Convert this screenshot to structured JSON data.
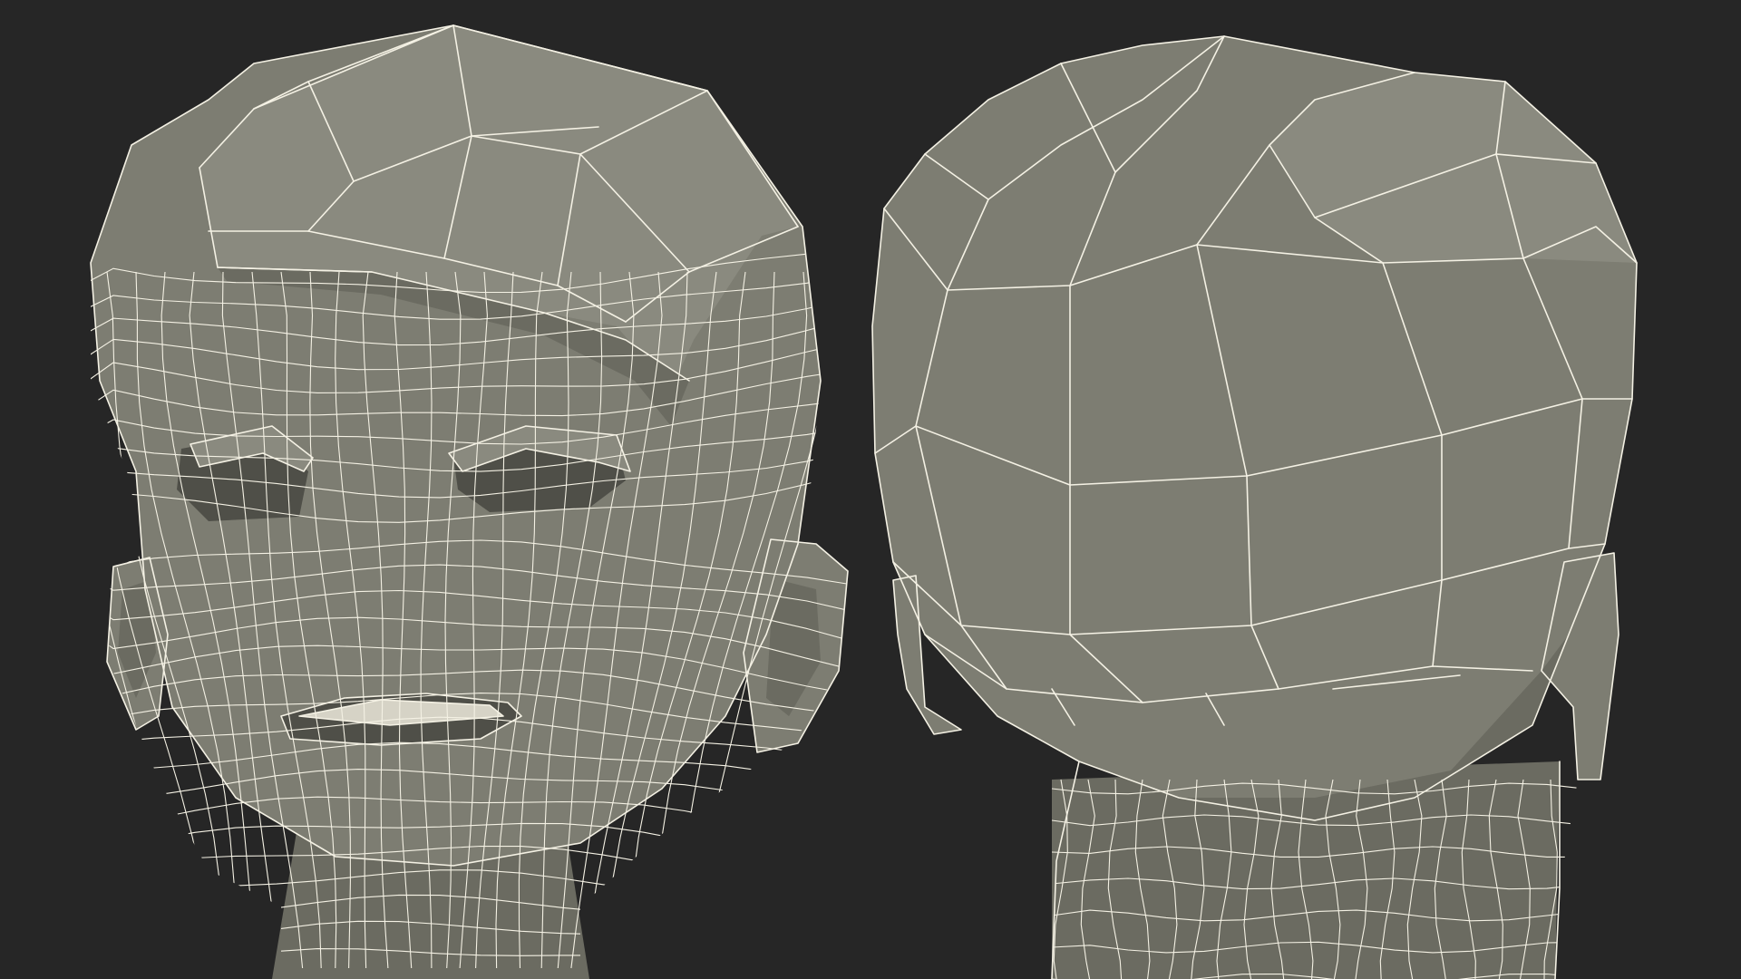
{
  "scene": {
    "background_color": "#262626",
    "mesh_color": "#7d7d72",
    "wire_color": "#f4f1e4"
  },
  "views": [
    {
      "id": "front",
      "icon": "head-front-wireframe-icon"
    },
    {
      "id": "back",
      "icon": "head-back-wireframe-icon"
    }
  ]
}
